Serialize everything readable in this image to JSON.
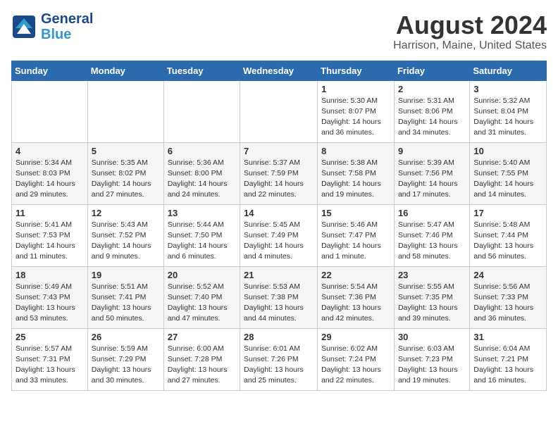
{
  "header": {
    "logo_line1": "General",
    "logo_line2": "Blue",
    "month": "August 2024",
    "location": "Harrison, Maine, United States"
  },
  "days_of_week": [
    "Sunday",
    "Monday",
    "Tuesday",
    "Wednesday",
    "Thursday",
    "Friday",
    "Saturday"
  ],
  "weeks": [
    [
      {
        "day": "",
        "info": ""
      },
      {
        "day": "",
        "info": ""
      },
      {
        "day": "",
        "info": ""
      },
      {
        "day": "",
        "info": ""
      },
      {
        "day": "1",
        "info": "Sunrise: 5:30 AM\nSunset: 8:07 PM\nDaylight: 14 hours\nand 36 minutes."
      },
      {
        "day": "2",
        "info": "Sunrise: 5:31 AM\nSunset: 8:06 PM\nDaylight: 14 hours\nand 34 minutes."
      },
      {
        "day": "3",
        "info": "Sunrise: 5:32 AM\nSunset: 8:04 PM\nDaylight: 14 hours\nand 31 minutes."
      }
    ],
    [
      {
        "day": "4",
        "info": "Sunrise: 5:34 AM\nSunset: 8:03 PM\nDaylight: 14 hours\nand 29 minutes."
      },
      {
        "day": "5",
        "info": "Sunrise: 5:35 AM\nSunset: 8:02 PM\nDaylight: 14 hours\nand 27 minutes."
      },
      {
        "day": "6",
        "info": "Sunrise: 5:36 AM\nSunset: 8:00 PM\nDaylight: 14 hours\nand 24 minutes."
      },
      {
        "day": "7",
        "info": "Sunrise: 5:37 AM\nSunset: 7:59 PM\nDaylight: 14 hours\nand 22 minutes."
      },
      {
        "day": "8",
        "info": "Sunrise: 5:38 AM\nSunset: 7:58 PM\nDaylight: 14 hours\nand 19 minutes."
      },
      {
        "day": "9",
        "info": "Sunrise: 5:39 AM\nSunset: 7:56 PM\nDaylight: 14 hours\nand 17 minutes."
      },
      {
        "day": "10",
        "info": "Sunrise: 5:40 AM\nSunset: 7:55 PM\nDaylight: 14 hours\nand 14 minutes."
      }
    ],
    [
      {
        "day": "11",
        "info": "Sunrise: 5:41 AM\nSunset: 7:53 PM\nDaylight: 14 hours\nand 11 minutes."
      },
      {
        "day": "12",
        "info": "Sunrise: 5:43 AM\nSunset: 7:52 PM\nDaylight: 14 hours\nand 9 minutes."
      },
      {
        "day": "13",
        "info": "Sunrise: 5:44 AM\nSunset: 7:50 PM\nDaylight: 14 hours\nand 6 minutes."
      },
      {
        "day": "14",
        "info": "Sunrise: 5:45 AM\nSunset: 7:49 PM\nDaylight: 14 hours\nand 4 minutes."
      },
      {
        "day": "15",
        "info": "Sunrise: 5:46 AM\nSunset: 7:47 PM\nDaylight: 14 hours\nand 1 minute."
      },
      {
        "day": "16",
        "info": "Sunrise: 5:47 AM\nSunset: 7:46 PM\nDaylight: 13 hours\nand 58 minutes."
      },
      {
        "day": "17",
        "info": "Sunrise: 5:48 AM\nSunset: 7:44 PM\nDaylight: 13 hours\nand 56 minutes."
      }
    ],
    [
      {
        "day": "18",
        "info": "Sunrise: 5:49 AM\nSunset: 7:43 PM\nDaylight: 13 hours\nand 53 minutes."
      },
      {
        "day": "19",
        "info": "Sunrise: 5:51 AM\nSunset: 7:41 PM\nDaylight: 13 hours\nand 50 minutes."
      },
      {
        "day": "20",
        "info": "Sunrise: 5:52 AM\nSunset: 7:40 PM\nDaylight: 13 hours\nand 47 minutes."
      },
      {
        "day": "21",
        "info": "Sunrise: 5:53 AM\nSunset: 7:38 PM\nDaylight: 13 hours\nand 44 minutes."
      },
      {
        "day": "22",
        "info": "Sunrise: 5:54 AM\nSunset: 7:36 PM\nDaylight: 13 hours\nand 42 minutes."
      },
      {
        "day": "23",
        "info": "Sunrise: 5:55 AM\nSunset: 7:35 PM\nDaylight: 13 hours\nand 39 minutes."
      },
      {
        "day": "24",
        "info": "Sunrise: 5:56 AM\nSunset: 7:33 PM\nDaylight: 13 hours\nand 36 minutes."
      }
    ],
    [
      {
        "day": "25",
        "info": "Sunrise: 5:57 AM\nSunset: 7:31 PM\nDaylight: 13 hours\nand 33 minutes."
      },
      {
        "day": "26",
        "info": "Sunrise: 5:59 AM\nSunset: 7:29 PM\nDaylight: 13 hours\nand 30 minutes."
      },
      {
        "day": "27",
        "info": "Sunrise: 6:00 AM\nSunset: 7:28 PM\nDaylight: 13 hours\nand 27 minutes."
      },
      {
        "day": "28",
        "info": "Sunrise: 6:01 AM\nSunset: 7:26 PM\nDaylight: 13 hours\nand 25 minutes."
      },
      {
        "day": "29",
        "info": "Sunrise: 6:02 AM\nSunset: 7:24 PM\nDaylight: 13 hours\nand 22 minutes."
      },
      {
        "day": "30",
        "info": "Sunrise: 6:03 AM\nSunset: 7:23 PM\nDaylight: 13 hours\nand 19 minutes."
      },
      {
        "day": "31",
        "info": "Sunrise: 6:04 AM\nSunset: 7:21 PM\nDaylight: 13 hours\nand 16 minutes."
      }
    ]
  ]
}
